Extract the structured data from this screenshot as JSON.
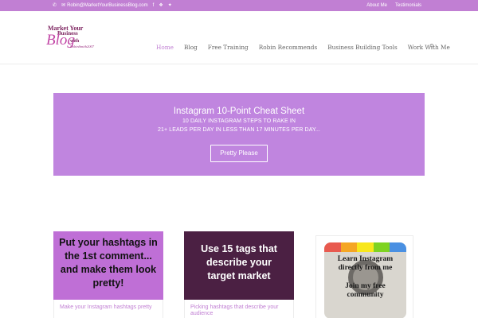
{
  "topbar": {
    "phone_icon": "phone-icon",
    "email_icon": "envelope-icon",
    "email": "Robin@MarketYourBusinessBlog.com",
    "social_icons": [
      "facebook-icon",
      "twitter-icon",
      "rss-icon"
    ],
    "links": [
      "About Me",
      "Testimonials"
    ],
    "bg_color": "#c17fd3"
  },
  "logo": {
    "line1": "Market Your",
    "line2": "Business",
    "line3": "Blog",
    "line4": "with",
    "line5": "RobinSmith2007"
  },
  "nav": {
    "items": [
      "Home",
      "Blog",
      "Free Training",
      "Robin Recommends",
      "Business Building Tools",
      "Work With Me"
    ],
    "active_color": "#c17fd3",
    "search_icon": "search-icon"
  },
  "hero": {
    "title": "Instagram 10-Point Cheat Sheet",
    "subtitle_line1": "10 DAILY INSTAGRAM STEPS TO RAKE IN",
    "subtitle_line2": "21+ LEADS PER DAY IN LESS THAN 17 MINUTES PER DAY...",
    "button": "Pretty Please",
    "bg_color": "#c085df"
  },
  "cards": [
    {
      "image_text": [
        "Put your hashtags in",
        "the 1st comment...",
        "and make them look",
        "pretty!"
      ],
      "caption": "Make your Instagram hashtags pretty"
    },
    {
      "image_text": [
        "Use 15 tags that",
        "describe your",
        "target market"
      ],
      "caption": "Picking hashtags that describe your audience"
    },
    {
      "image_text_top": [
        "Learn Instagram",
        "directly from me"
      ],
      "image_text_bottom": [
        "Join my free",
        "community"
      ]
    }
  ]
}
